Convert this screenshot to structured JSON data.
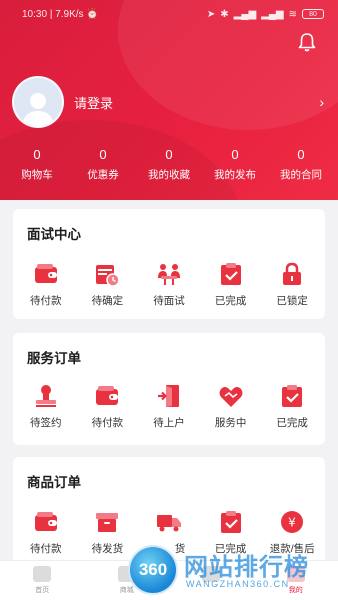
{
  "status": {
    "time": "10:30",
    "speed": "7.9K/s",
    "battery": "80"
  },
  "profile": {
    "login_label": "请登录",
    "arrow": "›"
  },
  "stats": [
    {
      "value": "0",
      "label": "购物车"
    },
    {
      "value": "0",
      "label": "优惠券"
    },
    {
      "value": "0",
      "label": "我的收藏"
    },
    {
      "value": "0",
      "label": "我的发布"
    },
    {
      "value": "0",
      "label": "我的合同"
    }
  ],
  "interview": {
    "title": "面试中心",
    "items": [
      {
        "label": "待付款",
        "icon": "wallet-icon"
      },
      {
        "label": "待确定",
        "icon": "calendar-clock-icon"
      },
      {
        "label": "待面试",
        "icon": "meeting-icon"
      },
      {
        "label": "已完成",
        "icon": "clipboard-check-icon"
      },
      {
        "label": "已锁定",
        "icon": "lock-icon"
      }
    ]
  },
  "service": {
    "title": "服务订单",
    "items": [
      {
        "label": "待签约",
        "icon": "stamp-icon"
      },
      {
        "label": "待付款",
        "icon": "wallet-icon"
      },
      {
        "label": "待上户",
        "icon": "door-enter-icon"
      },
      {
        "label": "服务中",
        "icon": "handshake-icon"
      },
      {
        "label": "已完成",
        "icon": "clipboard-check-icon"
      }
    ]
  },
  "goods": {
    "title": "商品订单",
    "items": [
      {
        "label": "待付款",
        "icon": "wallet-icon"
      },
      {
        "label": "待发货",
        "icon": "box-icon"
      },
      {
        "label": "货",
        "icon": "truck-icon"
      },
      {
        "label": "已完成",
        "icon": "clipboard-check-icon"
      },
      {
        "label": "退款/售后",
        "icon": "refund-icon"
      }
    ]
  },
  "tabbar": [
    {
      "label": "首页"
    },
    {
      "label": "商城"
    },
    {
      "label": ""
    },
    {
      "label": "我的"
    }
  ],
  "watermark": {
    "logo": "360",
    "title": "网站排行榜",
    "sub": "WANGZHAN360.CN"
  },
  "colors": {
    "brand": "#e8213f",
    "icon_red": "#e8323f",
    "bg": "#f2f2f4"
  }
}
